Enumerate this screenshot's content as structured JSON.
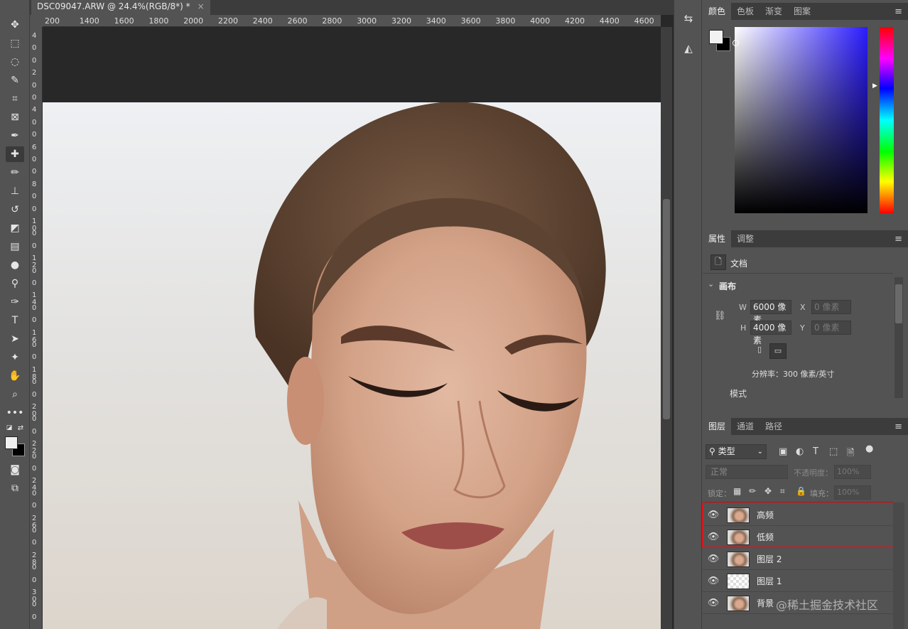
{
  "document": {
    "tab_title": "DSC09047.ARW @ 24.4%(RGB/8*) *",
    "close": "×"
  },
  "ruler": {
    "h_ticks": [
      "200",
      "1400",
      "1600",
      "1800",
      "2000",
      "2200",
      "2400",
      "2600",
      "2800",
      "3000",
      "3200",
      "3400",
      "3600",
      "3800",
      "4000",
      "4200",
      "4400",
      "4600"
    ],
    "v_ticks": [
      "4",
      "0",
      "0",
      "2",
      "0",
      "0",
      "4",
      "0",
      "0",
      "6",
      "0",
      "0",
      "8",
      "0",
      "0",
      "10",
      "0",
      "0",
      "12",
      "0",
      "0",
      "14",
      "0",
      "0",
      "16",
      "0",
      "0",
      "18",
      "0",
      "0",
      "20",
      "0",
      "0",
      "22",
      "0",
      "0",
      "24",
      "0",
      "0",
      "26",
      "0",
      "0",
      "28",
      "0",
      "0",
      "30",
      "0",
      "0"
    ]
  },
  "tools": [
    {
      "name": "move-tool",
      "glyph": "✥"
    },
    {
      "name": "marquee-tool",
      "glyph": "⬚"
    },
    {
      "name": "lasso-tool",
      "glyph": "◌"
    },
    {
      "name": "quick-select-tool",
      "glyph": "✎"
    },
    {
      "name": "crop-tool",
      "glyph": "⌗"
    },
    {
      "name": "frame-tool",
      "glyph": "⊠"
    },
    {
      "name": "eyedropper-tool",
      "glyph": "✒"
    },
    {
      "name": "healing-brush-tool",
      "glyph": "✚"
    },
    {
      "name": "brush-tool",
      "glyph": "✏"
    },
    {
      "name": "clone-stamp-tool",
      "glyph": "⊥"
    },
    {
      "name": "history-brush-tool",
      "glyph": "↺"
    },
    {
      "name": "eraser-tool",
      "glyph": "◩"
    },
    {
      "name": "gradient-tool",
      "glyph": "▤"
    },
    {
      "name": "blur-tool",
      "glyph": "●"
    },
    {
      "name": "dodge-tool",
      "glyph": "⚲"
    },
    {
      "name": "pen-tool",
      "glyph": "✑"
    },
    {
      "name": "type-tool",
      "glyph": "T"
    },
    {
      "name": "path-select-tool",
      "glyph": "➤"
    },
    {
      "name": "shape-tool",
      "glyph": "✦"
    },
    {
      "name": "hand-tool",
      "glyph": "✋"
    },
    {
      "name": "zoom-tool",
      "glyph": "⌕"
    },
    {
      "name": "more-tools",
      "glyph": "•••"
    }
  ],
  "color_panel": {
    "tabs": [
      "颜色",
      "色板",
      "渐变",
      "图案"
    ]
  },
  "properties_panel": {
    "tabs": [
      "属性",
      "调整"
    ],
    "doc_label": "文档",
    "section": "画布",
    "w_label": "W",
    "w_value": "6000 像素",
    "h_label": "H",
    "h_value": "4000 像素",
    "x_label": "X",
    "x_placeholder": "0 像素",
    "y_label": "Y",
    "y_placeholder": "0 像素",
    "resolution": "分辨率：300 像素/英寸",
    "mode_label": "模式"
  },
  "layers_panel": {
    "tabs": [
      "图层",
      "通道",
      "路径"
    ],
    "filter_kind": "类型",
    "blend_mode": "正常",
    "opacity_label": "不透明度：",
    "opacity_value": "100%",
    "lock_label": "锁定：",
    "fill_label": "填充：",
    "fill_value": "100%",
    "layers": [
      {
        "name": "高频",
        "thumb": "face"
      },
      {
        "name": "低频",
        "thumb": "face"
      },
      {
        "name": "图层 2",
        "thumb": "face"
      },
      {
        "name": "图层 1",
        "thumb": "trans"
      },
      {
        "name": "背景",
        "thumb": "face"
      }
    ]
  },
  "watermark": "@稀土掘金技术社区"
}
